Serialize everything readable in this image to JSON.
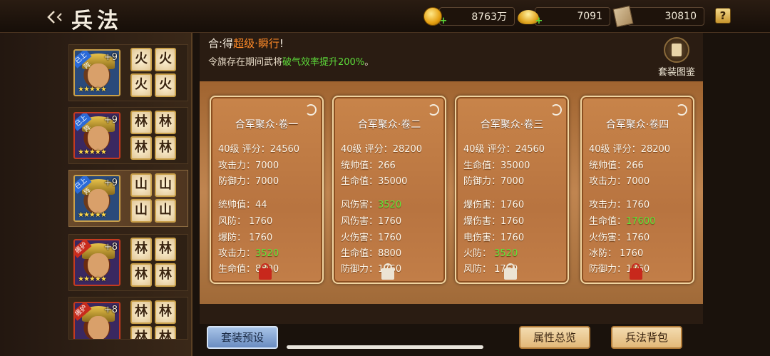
{
  "header": {
    "title": "兵法",
    "gold": "8763万",
    "ingot": "7091",
    "scroll": "30810",
    "help_label": "?"
  },
  "heroes": [
    {
      "level": "+9",
      "tag": "已上阵",
      "runes": [
        "火",
        "火",
        "火",
        "火"
      ],
      "selected": false
    },
    {
      "level": "+9",
      "tag": "已上阵",
      "runes": [
        "林",
        "林",
        "林",
        "林"
      ],
      "selected": false
    },
    {
      "level": "+9",
      "tag": "已上阵",
      "runes": [
        "山",
        "山",
        "山",
        "山"
      ],
      "selected": true
    },
    {
      "level": "+8",
      "tag": "援护",
      "runes": [
        "林",
        "林",
        "林",
        "林"
      ],
      "selected": false
    },
    {
      "level": "+8",
      "tag": "援护",
      "runes": [
        "林",
        "林",
        "林",
        "林"
      ],
      "selected": false
    }
  ],
  "notice": {
    "line1_prefix": "合:得",
    "line1_hl": "超级·瞬行",
    "line1_suffix": "!",
    "line2_prefix": "令旗存在期间武将",
    "line2_hl": "破气效率提升200%",
    "line2_suffix": "。"
  },
  "set_book": {
    "label": "套装图鉴"
  },
  "cards": [
    {
      "title": "合军聚众·卷一",
      "stats": [
        {
          "label": "40级 评分：",
          "value": "24560",
          "green": false
        },
        {
          "label": "攻击力：",
          "value": "7000",
          "green": false
        },
        {
          "label": "防御力：",
          "value": "7000",
          "green": false
        },
        {
          "label": "统帅值：",
          "value": "44",
          "green": false
        },
        {
          "label": "风防：   ",
          "value": "1760",
          "green": false
        },
        {
          "label": "爆防：   ",
          "value": "1760",
          "green": false
        },
        {
          "label": "攻击力：",
          "value": "3520",
          "green": true
        },
        {
          "label": "生命值：",
          "value": "8800",
          "green": false
        }
      ],
      "lock": "red"
    },
    {
      "title": "合军聚众·卷二",
      "stats": [
        {
          "label": "40级 评分：",
          "value": "28200",
          "green": false
        },
        {
          "label": "统帅值：",
          "value": "266",
          "green": false
        },
        {
          "label": "生命值：",
          "value": "35000",
          "green": false
        },
        {
          "label": "风伤害：",
          "value": "3520",
          "green": true
        },
        {
          "label": "风伤害：",
          "value": "1760",
          "green": false
        },
        {
          "label": "火伤害：",
          "value": "1760",
          "green": false
        },
        {
          "label": "生命值：",
          "value": "8800",
          "green": false
        },
        {
          "label": "防御力：",
          "value": "1760",
          "green": false
        }
      ],
      "lock": "white"
    },
    {
      "title": "合军聚众·卷三",
      "stats": [
        {
          "label": "40级 评分：",
          "value": "24560",
          "green": false
        },
        {
          "label": "生命值：",
          "value": "35000",
          "green": false
        },
        {
          "label": "防御力：",
          "value": "7000",
          "green": false
        },
        {
          "label": "爆伤害：",
          "value": "1760",
          "green": false
        },
        {
          "label": "爆伤害：",
          "value": "1760",
          "green": false
        },
        {
          "label": "电伤害：",
          "value": "1760",
          "green": false
        },
        {
          "label": "火防：   ",
          "value": "3520",
          "green": true
        },
        {
          "label": "风防：   ",
          "value": "1760",
          "green": false
        }
      ],
      "lock": "white"
    },
    {
      "title": "合军聚众·卷四",
      "stats": [
        {
          "label": "40级 评分：",
          "value": "28200",
          "green": false
        },
        {
          "label": "统帅值：",
          "value": "266",
          "green": false
        },
        {
          "label": "攻击力：",
          "value": "7000",
          "green": false
        },
        {
          "label": "攻击力：",
          "value": "1760",
          "green": false
        },
        {
          "label": "生命值：",
          "value": "17600",
          "green": true
        },
        {
          "label": "火伤害：",
          "value": "1760",
          "green": false
        },
        {
          "label": "冰防：   ",
          "value": "1760",
          "green": false
        },
        {
          "label": "防御力：",
          "value": "1760",
          "green": false
        }
      ],
      "lock": "red"
    }
  ],
  "buttons": {
    "preset": "套装预设",
    "attr_summary": "属性总览",
    "bag": "兵法背包"
  }
}
